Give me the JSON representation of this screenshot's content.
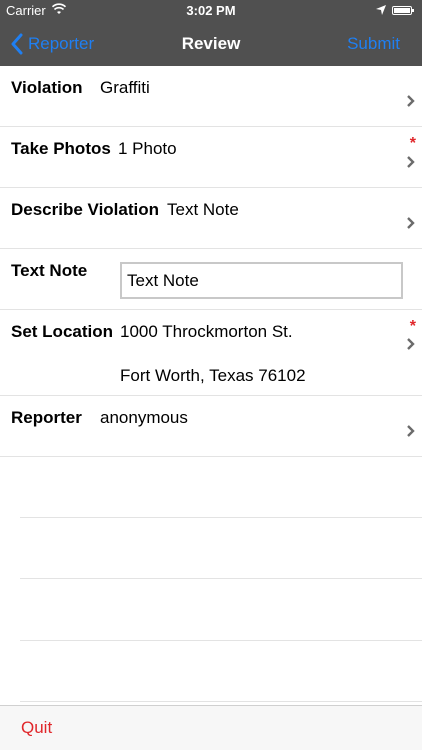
{
  "status": {
    "carrier": "Carrier",
    "time": "3:02 PM"
  },
  "nav": {
    "back_label": "Reporter",
    "title": "Review",
    "submit_label": "Submit"
  },
  "rows": {
    "violation": {
      "label": "Violation",
      "value": "Graffiti"
    },
    "photos": {
      "label": "Take Photos",
      "value": "1 Photo",
      "required": "*"
    },
    "describe": {
      "label": "Describe Violation",
      "value": "Text Note"
    },
    "text_note": {
      "label": "Text Note",
      "value": "Text Note"
    },
    "location": {
      "label": "Set Location",
      "line1": "1000 Throckmorton St.",
      "line2": "Fort Worth, Texas 76102",
      "required": "*"
    },
    "reporter": {
      "label": "Reporter",
      "value": "anonymous"
    }
  },
  "toolbar": {
    "quit_label": "Quit"
  },
  "colors": {
    "header_bg": "#505050",
    "accent": "#1f7ff2",
    "required": "#e0262a"
  }
}
